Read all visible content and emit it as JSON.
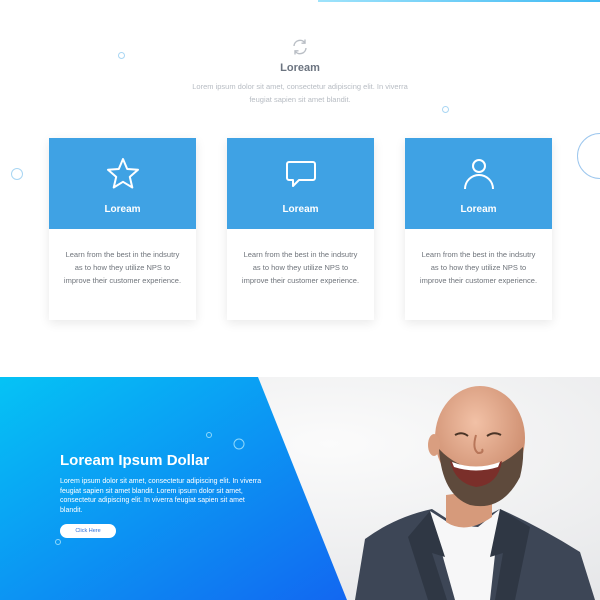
{
  "intro": {
    "icon": "refresh-icon",
    "title": "Loream",
    "text": "Lorem ipsum dolor sit amet, consectetur adipiscing elit. In viverra feugiat sapien sit amet blandit."
  },
  "features": [
    {
      "icon": "star-icon",
      "title": "Loream",
      "text": "Learn from the best in the indsutry as to how they utilize NPS to improve their customer experience."
    },
    {
      "icon": "chat-bubble-icon",
      "title": "Loream",
      "text": "Learn from the best in the indsutry as to how they utilize NPS to improve their customer experience."
    },
    {
      "icon": "user-icon",
      "title": "Loream",
      "text": "Learn from the best in the indsutry as to how they utilize NPS to improve their customer experience."
    }
  ],
  "hero": {
    "title": "Loream Ipsum Dollar",
    "text": "Lorem ipsum dolor sit amet, consectetur adipiscing elit. In viverra feugiat sapien sit amet blandit. Lorem ipsum dolor sit amet, consectetur adipiscing elit. In viverra feugiat sapien sit amet blandit.",
    "button_label": "Click Here",
    "photo": "smiling-man-photo"
  },
  "colors": {
    "card_blue": "#3fa2e4",
    "hero_gradient_start": "#05c3f5",
    "hero_gradient_end": "#1267f1",
    "text_gray": "#6f747b"
  }
}
